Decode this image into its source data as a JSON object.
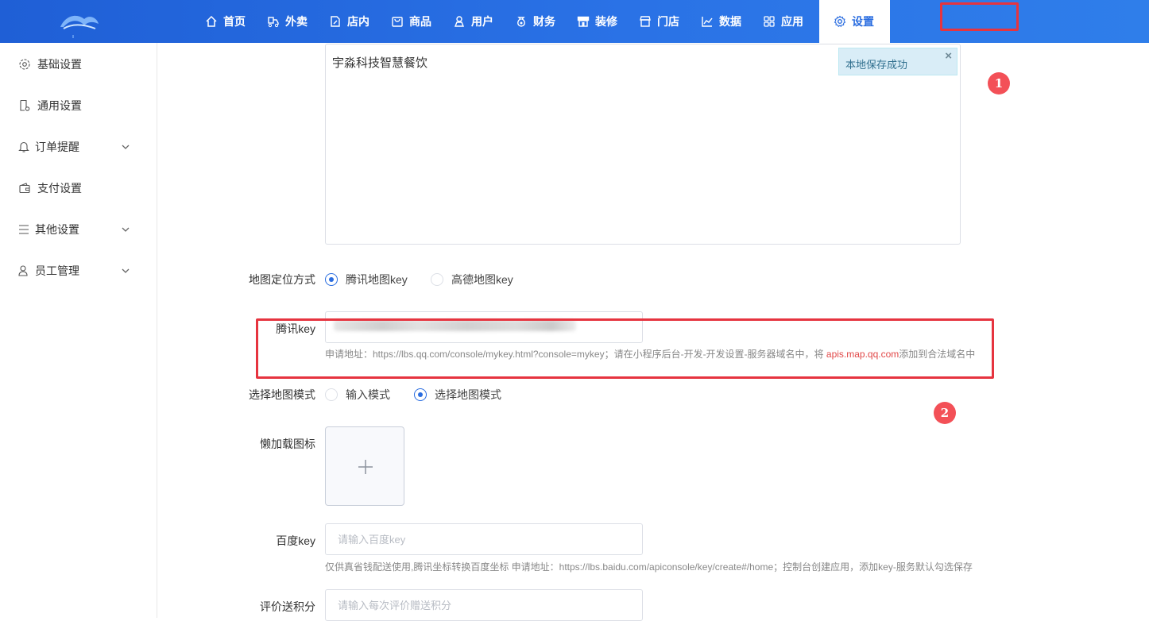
{
  "nav": {
    "items": [
      {
        "label": "首页",
        "icon": "home-icon"
      },
      {
        "label": "外卖",
        "icon": "delivery-icon"
      },
      {
        "label": "店内",
        "icon": "store-edit-icon"
      },
      {
        "label": "商品",
        "icon": "bag-icon"
      },
      {
        "label": "用户",
        "icon": "user-icon"
      },
      {
        "label": "财务",
        "icon": "money-bag-icon"
      },
      {
        "label": "装修",
        "icon": "storefront-icon"
      },
      {
        "label": "门店",
        "icon": "shop-icon"
      },
      {
        "label": "数据",
        "icon": "chart-icon"
      },
      {
        "label": "应用",
        "icon": "apps-grid-icon"
      }
    ],
    "active": {
      "label": "设置",
      "icon": "gear-icon"
    }
  },
  "sidebar": {
    "items": [
      {
        "label": "基础设置",
        "icon": "gear-icon",
        "expandable": false
      },
      {
        "label": "通用设置",
        "icon": "document-icon",
        "expandable": false
      },
      {
        "label": "订单提醒",
        "icon": "bell-icon",
        "expandable": true
      },
      {
        "label": "支付设置",
        "icon": "wallet-icon",
        "expandable": false
      },
      {
        "label": "其他设置",
        "icon": "menu-lines-icon",
        "expandable": true
      },
      {
        "label": "员工管理",
        "icon": "person-icon",
        "expandable": true
      }
    ]
  },
  "main": {
    "textarea_value": "宇淼科技智慧餐饮",
    "toast": {
      "text": "本地保存成功",
      "close": "×"
    },
    "badges": {
      "one": "1",
      "two": "2"
    },
    "map_location": {
      "label": "地图定位方式",
      "options": [
        "腾讯地图key",
        "高德地图key"
      ],
      "selected": "腾讯地图key"
    },
    "tencent_key": {
      "label": "腾讯key",
      "hint_prefix": "申请地址：https://lbs.qq.com/console/mykey.html?console=mykey；请在小程序后台-开发-开发设置-服务器域名中，将 ",
      "hint_domain": "apis.map.qq.com",
      "hint_suffix": "添加到合法域名中"
    },
    "map_mode": {
      "label": "选择地图模式",
      "options": [
        "输入模式",
        "选择地图模式"
      ],
      "selected": "选择地图模式"
    },
    "lazy_icon": {
      "label": "懒加载图标"
    },
    "baidu_key": {
      "label": "百度key",
      "placeholder": "请输入百度key",
      "hint": "仅供真省钱配送使用,腾讯坐标转换百度坐标 申请地址：https://lbs.baidu.com/apiconsole/key/create#/home；控制台创建应用，添加key-服务默认勾选保存"
    },
    "review_points": {
      "label": "评价送积分",
      "placeholder": "请输入每次评价赠送积分"
    }
  },
  "colors": {
    "brand": "#2a6de0",
    "highlight": "#e6343f",
    "badge": "#f35057"
  }
}
